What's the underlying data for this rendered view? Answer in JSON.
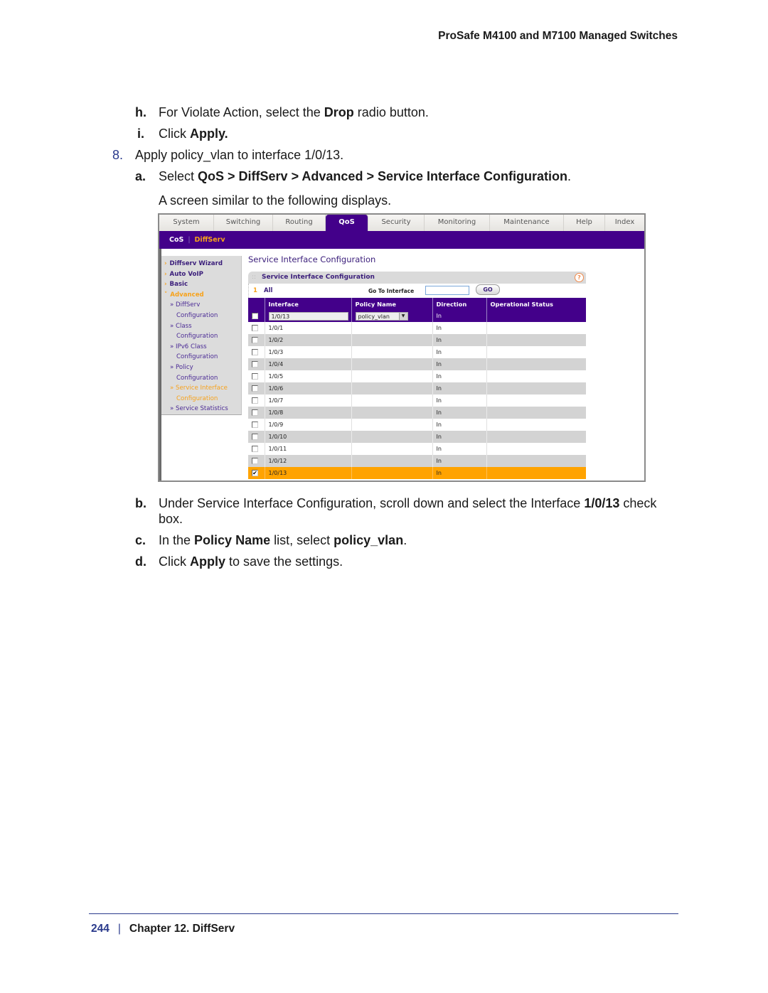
{
  "running_header": "ProSafe M4100 and M7100 Managed Switches",
  "steps_before": [
    {
      "marker": "h.",
      "parts": [
        {
          "t": "For Violate Action, select the "
        },
        {
          "t": "Drop",
          "b": true
        },
        {
          "t": " radio button."
        }
      ]
    },
    {
      "marker": "i.",
      "parts": [
        {
          "t": "Click "
        },
        {
          "t": "Apply.",
          "b": true
        }
      ]
    },
    {
      "marker": "8.",
      "parts": [
        {
          "t": "Apply policy_vlan to interface 1/0/13."
        }
      ]
    },
    {
      "marker": "a.",
      "parts": [
        {
          "t": "Select "
        },
        {
          "t": "QoS > DiffServ > Advanced > Service Interface Configuration",
          "b": true
        },
        {
          "t": "."
        }
      ]
    }
  ],
  "screen_intro": "A screen similar to the following displays.",
  "screenshot": {
    "tabs": [
      {
        "label": "System"
      },
      {
        "label": "Switching"
      },
      {
        "label": "Routing"
      },
      {
        "label": "QoS",
        "active": true
      },
      {
        "label": "Security"
      },
      {
        "label": "Monitoring"
      },
      {
        "label": "Maintenance"
      },
      {
        "label": "Help"
      },
      {
        "label": "Index"
      }
    ],
    "subnav": {
      "cos": "CoS",
      "separator": "|",
      "diffserv": "DiffServ"
    },
    "leftnav": [
      {
        "label": "Diffserv Wizard",
        "level": "top"
      },
      {
        "label": "Auto VoIP",
        "level": "top"
      },
      {
        "label": "Basic",
        "level": "top"
      },
      {
        "label": "Advanced",
        "level": "top",
        "open": true
      },
      {
        "label": "» DiffServ",
        "level": "sub"
      },
      {
        "label": "Configuration",
        "level": "cont"
      },
      {
        "label": "» Class",
        "level": "sub"
      },
      {
        "label": "Configuration",
        "level": "cont"
      },
      {
        "label": "» IPv6 Class",
        "level": "sub"
      },
      {
        "label": "Configuration",
        "level": "cont"
      },
      {
        "label": "» Policy",
        "level": "sub"
      },
      {
        "label": "Configuration",
        "level": "cont"
      },
      {
        "label": "» Service Interface",
        "level": "sub",
        "current": true
      },
      {
        "label": "Configuration",
        "level": "cont",
        "current": true
      },
      {
        "label": "» Service Statistics",
        "level": "sub"
      }
    ],
    "page_title": "Service Interface Configuration",
    "panel_title": "Service Interface Configuration",
    "help_icon": "?",
    "toolbar": {
      "page_num": "1",
      "all": "All",
      "goto_label": "Go To Interface",
      "goto_value": "",
      "go_button": "GO"
    },
    "columns": [
      "",
      "Interface",
      "Policy Name",
      "Direction",
      "Operational Status"
    ],
    "edit_row": {
      "interface": "1/0/13",
      "policy": "policy_vlan",
      "direction": "In",
      "status": ""
    },
    "rows": [
      {
        "interface": "1/0/1",
        "policy": "",
        "direction": "In",
        "status": "",
        "checked": false
      },
      {
        "interface": "1/0/2",
        "policy": "",
        "direction": "In",
        "status": "",
        "checked": false
      },
      {
        "interface": "1/0/3",
        "policy": "",
        "direction": "In",
        "status": "",
        "checked": false
      },
      {
        "interface": "1/0/4",
        "policy": "",
        "direction": "In",
        "status": "",
        "checked": false
      },
      {
        "interface": "1/0/5",
        "policy": "",
        "direction": "In",
        "status": "",
        "checked": false
      },
      {
        "interface": "1/0/6",
        "policy": "",
        "direction": "In",
        "status": "",
        "checked": false
      },
      {
        "interface": "1/0/7",
        "policy": "",
        "direction": "In",
        "status": "",
        "checked": false
      },
      {
        "interface": "1/0/8",
        "policy": "",
        "direction": "In",
        "status": "",
        "checked": false
      },
      {
        "interface": "1/0/9",
        "policy": "",
        "direction": "In",
        "status": "",
        "checked": false
      },
      {
        "interface": "1/0/10",
        "policy": "",
        "direction": "In",
        "status": "",
        "checked": false
      },
      {
        "interface": "1/0/11",
        "policy": "",
        "direction": "In",
        "status": "",
        "checked": false
      },
      {
        "interface": "1/0/12",
        "policy": "",
        "direction": "In",
        "status": "",
        "checked": false
      },
      {
        "interface": "1/0/13",
        "policy": "",
        "direction": "In",
        "status": "",
        "checked": true
      }
    ],
    "colors": {
      "brand_purple": "#43008a",
      "accent_orange": "#f7a21b",
      "selected_row": "#ffa300"
    }
  },
  "steps_after": [
    {
      "marker": "b.",
      "parts": [
        {
          "t": "Under Service Interface Configuration, scroll down and select the Interface "
        },
        {
          "t": "1/0/13",
          "b": true
        },
        {
          "t": " check box."
        }
      ]
    },
    {
      "marker": "c.",
      "parts": [
        {
          "t": "In the "
        },
        {
          "t": "Policy Name",
          "b": true
        },
        {
          "t": " list, select "
        },
        {
          "t": "policy_vlan",
          "b": true
        },
        {
          "t": "."
        }
      ]
    },
    {
      "marker": "d.",
      "parts": [
        {
          "t": "Click "
        },
        {
          "t": "Apply",
          "b": true
        },
        {
          "t": " to save the settings."
        }
      ]
    }
  ],
  "footer": {
    "page_number": "244",
    "separator": "|",
    "chapter": "Chapter 12. DiffServ"
  }
}
